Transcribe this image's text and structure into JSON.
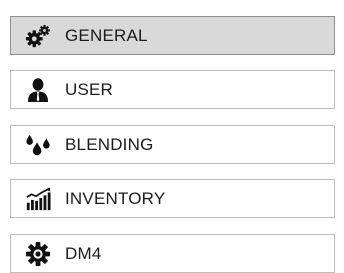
{
  "menu": {
    "items": [
      {
        "label": "GENERAL",
        "icon": "gears-icon",
        "selected": true
      },
      {
        "label": "USER",
        "icon": "user-icon",
        "selected": false
      },
      {
        "label": "BLENDING",
        "icon": "drops-icon",
        "selected": false
      },
      {
        "label": "INVENTORY",
        "icon": "bar-chart-icon",
        "selected": false
      },
      {
        "label": "DM4",
        "icon": "gear-icon",
        "selected": false
      }
    ]
  },
  "colors": {
    "selected_background": "#d9d9d9",
    "border": "#bdbdbd",
    "icon": "#111111",
    "text": "#1b1b1b"
  }
}
